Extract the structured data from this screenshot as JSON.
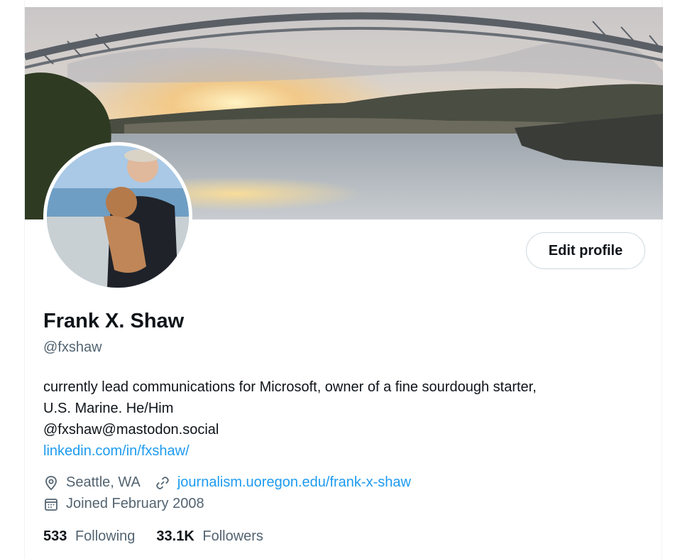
{
  "profile": {
    "name": "Frank X. Shaw",
    "handle": "@fxshaw",
    "bio_lines": [
      "currently lead communications for Microsoft, owner of a fine sourdough starter,",
      "U.S. Marine. He/Him",
      "@fxshaw@mastodon.social"
    ],
    "bio_link": "linkedin.com/in/fxshaw/",
    "location": "Seattle, WA",
    "website": "journalism.uoregon.edu/frank-x-shaw",
    "joined": "Joined February 2008",
    "following_count": "533",
    "following_label": "Following",
    "followers_count": "33.1K",
    "followers_label": "Followers"
  },
  "actions": {
    "edit_profile": "Edit profile"
  },
  "icons": {
    "location": "location-pin-icon",
    "website": "link-icon",
    "joined": "calendar-icon"
  },
  "colors": {
    "link": "#1d9bf0",
    "secondary_text": "#536471",
    "primary_text": "#0f1419",
    "border": "#cfd9de"
  }
}
